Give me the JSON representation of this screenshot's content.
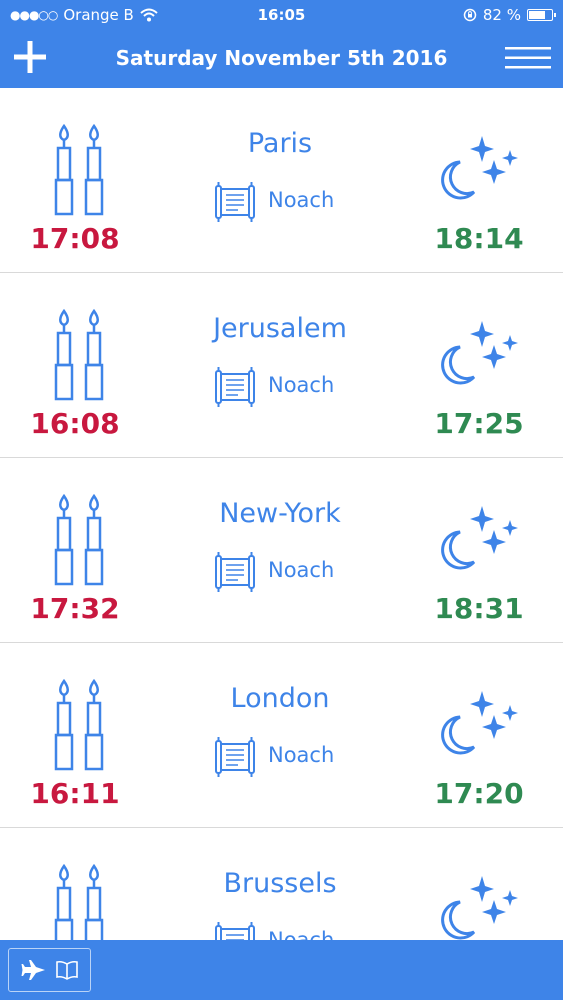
{
  "status_bar": {
    "carrier": "Orange B",
    "time": "16:05",
    "battery": "82 %",
    "battery_level": 0.82,
    "icons": [
      "signal-dots-icon",
      "wifi-icon",
      "orientation-lock-icon",
      "battery-icon"
    ]
  },
  "nav": {
    "title": "Saturday November 5th 2016",
    "left_icon": "plus-icon",
    "right_icon": "hamburger-menu-icon"
  },
  "colors": {
    "accent": "#3e84e8",
    "candle_time": "#c8183f",
    "havdalah_time": "#2f8a52",
    "divider": "#d9d9d9"
  },
  "rows": [
    {
      "city": "Paris",
      "parasha": "Noach",
      "candle_lighting": "17:08",
      "havdalah": "18:14"
    },
    {
      "city": "Jerusalem",
      "parasha": "Noach",
      "candle_lighting": "16:08",
      "havdalah": "17:25"
    },
    {
      "city": "New-York",
      "parasha": "Noach",
      "candle_lighting": "17:32",
      "havdalah": "18:31"
    },
    {
      "city": "London",
      "parasha": "Noach",
      "candle_lighting": "16:11",
      "havdalah": "17:20"
    },
    {
      "city": "Brussels",
      "parasha": "Noach",
      "candle_lighting": "",
      "havdalah": ""
    }
  ],
  "tab_bar": {
    "icons": [
      "airplane-icon",
      "book-icon"
    ]
  }
}
